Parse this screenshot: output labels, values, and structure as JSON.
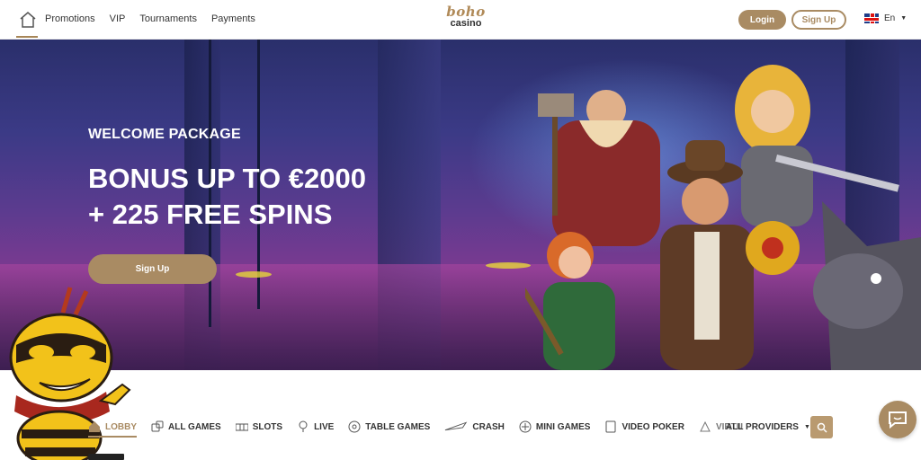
{
  "header": {
    "nav": [
      "Promotions",
      "VIP",
      "Tournaments",
      "Payments"
    ],
    "logo_top": "boho",
    "logo_bottom": "casino",
    "login_label": "Login",
    "signup_label": "Sign Up",
    "language": "En"
  },
  "hero": {
    "kicker": "WELCOME PACKAGE",
    "headline_line1": "BONUS UP TO €2000",
    "headline_line2": "+ 225 FREE SPINS",
    "cta_label": "Sign Up"
  },
  "categories": {
    "items": [
      "LOBBY",
      "ALL GAMES",
      "SLOTS",
      "LIVE",
      "TABLE GAMES",
      "CRASH",
      "MINI GAMES",
      "VIDEO POKER",
      "VIRTU"
    ],
    "active": "LOBBY",
    "providers_label": "ALL PROVIDERS"
  },
  "colors": {
    "accent": "#a98b63",
    "hero_top": "#2a2f6b",
    "hero_bottom": "#4a2a66"
  },
  "icons": {
    "home": "home-icon",
    "search": "search-icon",
    "chat": "chat-icon",
    "flag": "uk-flag-icon"
  }
}
